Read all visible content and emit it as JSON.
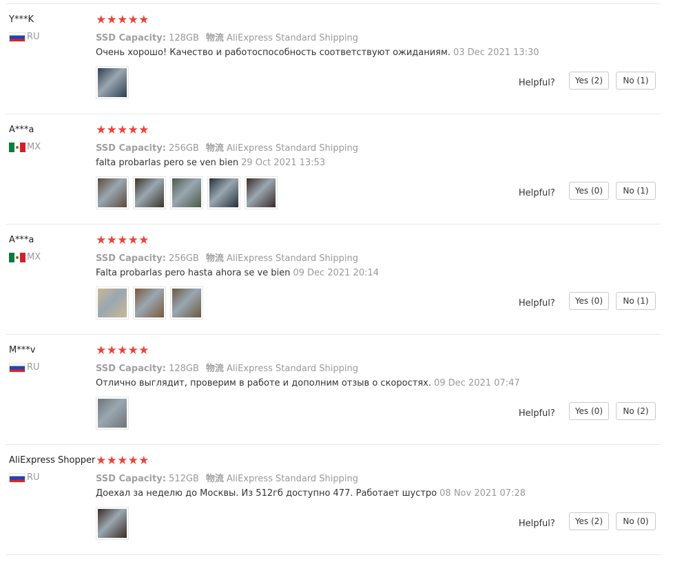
{
  "reviews": [
    {
      "buyer": "Y***K",
      "country": "RU",
      "flag": "ru-flag-icon",
      "stars": 5,
      "spec_key": "SSD Capacity:",
      "spec_value": "128GB",
      "ship_key": "物流",
      "ship_value": "AliExpress Standard Shipping",
      "text": "Очень хорошо! Качество и работоспособность соответствуют ожиданиям.",
      "date": "03 Dec 2021 13:30",
      "photos": [
        "#2d3f52"
      ],
      "helpful_label": "Helpful?",
      "yes": "Yes (2)",
      "no": "No (1)"
    },
    {
      "buyer": "A***a",
      "country": "MX",
      "flag": "mx-flag-icon",
      "stars": 5,
      "spec_key": "SSD Capacity:",
      "spec_value": "256GB",
      "ship_key": "物流",
      "ship_value": "AliExpress Standard Shipping",
      "text": "falta probarlas pero se ven bien",
      "date": "29 Oct 2021 13:53",
      "photos": [
        "#5b4a3a",
        "#3d3428",
        "#4b5a4a",
        "#24303a",
        "#3a2a26"
      ],
      "helpful_label": "Helpful?",
      "yes": "Yes (0)",
      "no": "No (1)"
    },
    {
      "buyer": "A***a",
      "country": "MX",
      "flag": "mx-flag-icon",
      "stars": 5,
      "spec_key": "SSD Capacity:",
      "spec_value": "256GB",
      "ship_key": "物流",
      "ship_value": "AliExpress Standard Shipping",
      "text": "Falta probarlas pero hasta ahora se ve bien",
      "date": "09 Dec 2021 20:14",
      "photos": [
        "#c9b893",
        "#7a5a3a",
        "#6a5a42"
      ],
      "helpful_label": "Helpful?",
      "yes": "Yes (0)",
      "no": "No (1)"
    },
    {
      "buyer": "M***v",
      "country": "RU",
      "flag": "ru-flag-icon",
      "stars": 5,
      "spec_key": "SSD Capacity:",
      "spec_value": "128GB",
      "ship_key": "物流",
      "ship_value": "AliExpress Standard Shipping",
      "text": "Отлично выглядит, проверим в работе и дополним отзыв о скоростях.",
      "date": "09 Dec 2021 07:47",
      "photos": [
        "#6f7478"
      ],
      "helpful_label": "Helpful?",
      "yes": "Yes (0)",
      "no": "No (2)"
    },
    {
      "buyer": "AliExpress Shopper",
      "country": "RU",
      "flag": "ru-flag-icon",
      "stars": 5,
      "spec_key": "SSD Capacity:",
      "spec_value": "512GB",
      "ship_key": "物流",
      "ship_value": "AliExpress Standard Shipping",
      "text": "Доехал за неделю до Москвы. Из 512гб доступно 477. Работает шустро",
      "date": "08 Nov 2021 07:28",
      "photos": [
        "#3a2a24"
      ],
      "helpful_label": "Helpful?",
      "yes": "Yes (2)",
      "no": "No (0)"
    }
  ]
}
